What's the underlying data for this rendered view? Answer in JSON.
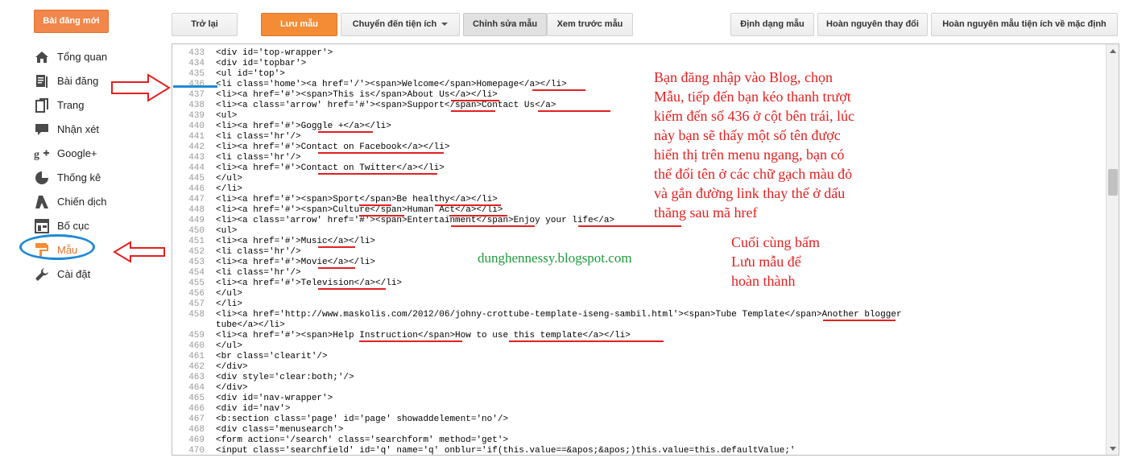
{
  "sidebar": {
    "new_post": "Bài đăng mới",
    "items": [
      {
        "label": "Tổng quan",
        "icon": "home-icon"
      },
      {
        "label": "Bài đăng",
        "icon": "posts-icon"
      },
      {
        "label": "Trang",
        "icon": "pages-icon"
      },
      {
        "label": "Nhận xét",
        "icon": "comments-icon"
      },
      {
        "label": "Google+",
        "icon": "google-plus-icon"
      },
      {
        "label": "Thống kê",
        "icon": "stats-icon"
      },
      {
        "label": "Chiến dịch",
        "icon": "campaign-icon"
      },
      {
        "label": "Bố cục",
        "icon": "layout-icon"
      },
      {
        "label": "Mẫu",
        "icon": "template-icon"
      },
      {
        "label": "Cài đặt",
        "icon": "settings-icon"
      }
    ],
    "active_index": 8
  },
  "toolbar": {
    "back": "Trở lại",
    "save": "Lưu mẫu",
    "jump": "Chuyển đến tiện ích",
    "edit": "Chỉnh sửa mẫu",
    "preview": "Xem trước mẫu",
    "format": "Định dạng mẫu",
    "revert": "Hoàn nguyên thay đổi",
    "revert_widgets": "Hoàn nguyên mẫu tiện ích về mặc định"
  },
  "editor": {
    "lines": [
      {
        "n": "433",
        "t": "<div id='top-wrapper'>"
      },
      {
        "n": "434",
        "t": "<div id='topbar'>"
      },
      {
        "n": "435",
        "t": "<ul id='top'>"
      },
      {
        "n": "436",
        "t": "<li class='home'><a href='/'><span>Welcome</span>Homepage</a></li>"
      },
      {
        "n": "437",
        "t": "<li><a href='#'><span>This is</span>About Us</a></li>"
      },
      {
        "n": "438",
        "t": "<li><a class='arrow' href='#'><span>Support</span>Contact Us</a>"
      },
      {
        "n": "439",
        "t": "<ul>"
      },
      {
        "n": "440",
        "t": "<li><a href='#'>Goggle +</a></li>"
      },
      {
        "n": "441",
        "t": "<li class='hr'/>"
      },
      {
        "n": "442",
        "t": "<li><a href='#'>Contact on Facebook</a></li>"
      },
      {
        "n": "443",
        "t": "<li class='hr'/>"
      },
      {
        "n": "444",
        "t": "<li><a href='#'>Contact on Twitter</a></li>"
      },
      {
        "n": "445",
        "t": "</ul>"
      },
      {
        "n": "446",
        "t": "</li>"
      },
      {
        "n": "447",
        "t": "<li><a href='#'><span>Sport</span>Be healthy</a></li>"
      },
      {
        "n": "448",
        "t": "<li><a href='#'><span>Culture</span>Human Act</a></li>"
      },
      {
        "n": "449",
        "t": "<li><a class='arrow' href='#'><span>Entertainment</span>Enjoy your life</a>"
      },
      {
        "n": "450",
        "t": "<ul>"
      },
      {
        "n": "451",
        "t": "<li><a href='#'>Music</a></li>"
      },
      {
        "n": "452",
        "t": "<li class='hr'/>"
      },
      {
        "n": "453",
        "t": "<li><a href='#'>Movie</a></li>"
      },
      {
        "n": "454",
        "t": "<li class='hr'/>"
      },
      {
        "n": "455",
        "t": "<li><a href='#'>Television</a></li>"
      },
      {
        "n": "456",
        "t": "</ul>"
      },
      {
        "n": "457",
        "t": "</li>"
      },
      {
        "n": "458",
        "t": "<li><a href='http://www.maskolis.com/2012/06/johny-crottube-template-iseng-sambil.html'><span>Tube Template</span>Another blogger"
      },
      {
        "n": "",
        "t": "tube</a></li>"
      },
      {
        "n": "459",
        "t": "<li><a href='#'><span>Help Instruction</span>How to use this template</a></li>"
      },
      {
        "n": "460",
        "t": "</ul>"
      },
      {
        "n": "461",
        "t": "<br class='clearit'/>"
      },
      {
        "n": "462",
        "t": "</div>"
      },
      {
        "n": "463",
        "t": "<div style='clear:both;'/>"
      },
      {
        "n": "464",
        "t": "</div>"
      },
      {
        "n": "465",
        "t": "<div id='nav-wrapper'>"
      },
      {
        "n": "466",
        "t": "<div id='nav'>"
      },
      {
        "n": "467",
        "t": "<b:section class='page' id='page' showaddelement='no'/>"
      },
      {
        "n": "468",
        "t": "<div class='menusearch'>"
      },
      {
        "n": "469",
        "t": "<form action='/search' class='searchform' method='get'>"
      },
      {
        "n": "470",
        "t": "<input class='searchfield' id='q' name='q' onblur='if(this.value==&apos;&apos;)this.value=this.defaultValue;'"
      }
    ]
  },
  "annotations": {
    "note1": [
      "Bạn đăng nhập vào Blog, chọn",
      "Mẫu, tiếp đến bạn kéo thanh trượt",
      "kiếm đến số 436 ở cột bên trái, lúc",
      "này bạn sẽ thấy một số tên được",
      "hiển thị trên menu ngang, bạn có",
      "thể đổi tên ở các chữ gạch màu đỏ",
      "và gắn đường link thay thế ở dấu",
      "thăng sau mã href"
    ],
    "note2": [
      "Cuối cùng bấm",
      "Lưu mẫu để",
      "hoàn thành"
    ],
    "credit": "dunghennessy.blogspot.com"
  },
  "colors": {
    "accent": "#f48c35",
    "annotation": "#e32020",
    "credit": "#1e9b3c",
    "highlight": "#1f8ad6"
  }
}
